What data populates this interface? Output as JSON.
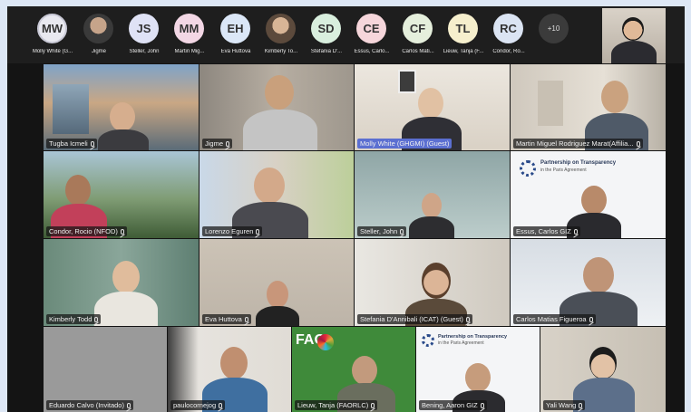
{
  "strip": {
    "participants": [
      {
        "initials": "MW",
        "name": "Molly White (G...",
        "color": "#e9e9f0"
      },
      {
        "initials": "",
        "name": "Jigme",
        "color": "#c6a48a",
        "photo": true
      },
      {
        "initials": "JS",
        "name": "Steller, John",
        "color": "#dfe2f5"
      },
      {
        "initials": "MM",
        "name": "Martin Mig...",
        "color": "#f3d7e5"
      },
      {
        "initials": "EH",
        "name": "Eva Huttova",
        "color": "#dbe7f7"
      },
      {
        "initials": "",
        "name": "Kimberly To...",
        "color": "#d1b49c",
        "photo": true
      },
      {
        "initials": "SD",
        "name": "Stefania D'...",
        "color": "#d9efde"
      },
      {
        "initials": "CE",
        "name": "Essus, Carlo...",
        "color": "#f6d6db"
      },
      {
        "initials": "CF",
        "name": "Carlos Mati...",
        "color": "#e5efdc"
      },
      {
        "initials": "TL",
        "name": "Lieuw, Tanja (F...",
        "color": "#f6efcd"
      },
      {
        "initials": "RC",
        "name": "Condor, Ro...",
        "color": "#dbe4f3"
      }
    ],
    "more_label": "+10"
  },
  "tiles": [
    {
      "name": "Tugba Icmeli"
    },
    {
      "name": "Jigme"
    },
    {
      "name": "Molly White (GHGMI) (Guest)"
    },
    {
      "name": "Martin Miguel Rodriguez Marat(Affilia..."
    },
    {
      "name": "Condor, Rocio (NFOD)"
    },
    {
      "name": "Lorenzo Eguren"
    },
    {
      "name": "Steller, John"
    },
    {
      "name": "Essus, Carlos GIZ"
    },
    {
      "name": "Kimberly Todd"
    },
    {
      "name": "Eva Huttova"
    },
    {
      "name": "Stefania D'Annibali (ICAT) (Guest)"
    },
    {
      "name": "Carlos Matias Figueroa"
    },
    {
      "name": "Eduardo Calvo (Invitado)"
    },
    {
      "name": "paulocornejog"
    },
    {
      "name": "Lieuw, Tanja (FAORLC)"
    },
    {
      "name": "Bening, Aaron GIZ"
    },
    {
      "name": "Yali Wang"
    }
  ],
  "slides": {
    "transparency_title": "Partnership on Transparency",
    "transparency_sub": "in the Paris Agreement",
    "fao_label": "FAO"
  },
  "colors": {
    "app_bg": "#141414",
    "strip_bg": "#1e1e1e",
    "page_bg": "#dde7f5"
  }
}
